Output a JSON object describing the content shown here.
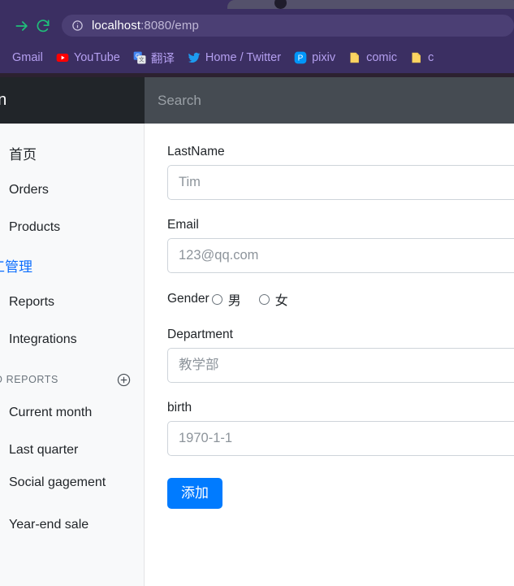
{
  "browser": {
    "forward_icon": "forward-arrow-icon",
    "reload_icon": "reload-icon",
    "site_info_icon": "site-info-icon",
    "url_host": "localhost",
    "url_path": ":8080/emp",
    "url_full": "localhost:8080/emp",
    "bookmarks": [
      {
        "label": "Gmail",
        "icon": "gmail-icon"
      },
      {
        "label": "YouTube",
        "icon": "youtube-icon"
      },
      {
        "label": "翻译",
        "icon": "google-translate-icon"
      },
      {
        "label": "Home / Twitter",
        "icon": "twitter-icon"
      },
      {
        "label": "pixiv",
        "icon": "pixiv-icon"
      },
      {
        "label": "comic",
        "icon": "folder-icon"
      },
      {
        "label": "c",
        "icon": "folder-icon"
      }
    ]
  },
  "app": {
    "brand": "min",
    "search_placeholder": "Search",
    "sidebar": {
      "items": [
        {
          "label": "首页"
        },
        {
          "label": "Orders"
        },
        {
          "label": "Products"
        },
        {
          "label": "工管理"
        },
        {
          "label": "Reports"
        },
        {
          "label": "Integrations"
        }
      ],
      "section_heading": "VED REPORTS",
      "add_icon": "plus-circle-icon",
      "saved_reports": [
        {
          "label": "Current month"
        },
        {
          "label": "Last quarter"
        },
        {
          "label": "Social\ngagement"
        },
        {
          "label": "Year-end sale"
        }
      ]
    },
    "form": {
      "lastname_label": "LastName",
      "lastname_placeholder": "Tim",
      "lastname_value": "",
      "email_label": "Email",
      "email_placeholder": "123@qq.com",
      "email_value": "",
      "gender_label": "Gender",
      "gender_options": [
        {
          "label": "男",
          "checked": false
        },
        {
          "label": "女",
          "checked": false
        }
      ],
      "department_label": "Department",
      "department_placeholder": "教学部",
      "department_value": "",
      "birth_label": "birth",
      "birth_placeholder": "1970-1-1",
      "birth_value": "",
      "submit_label": "添加"
    }
  },
  "colors": {
    "browser_chrome": "#3b2f62",
    "bookmark_text": "#b49ff0",
    "brand_bar": "#212529",
    "navbar": "#454b52",
    "sidebar_bg": "#f8f9fa",
    "accent_blue": "#007bff",
    "link_blue": "#0d6efd"
  }
}
